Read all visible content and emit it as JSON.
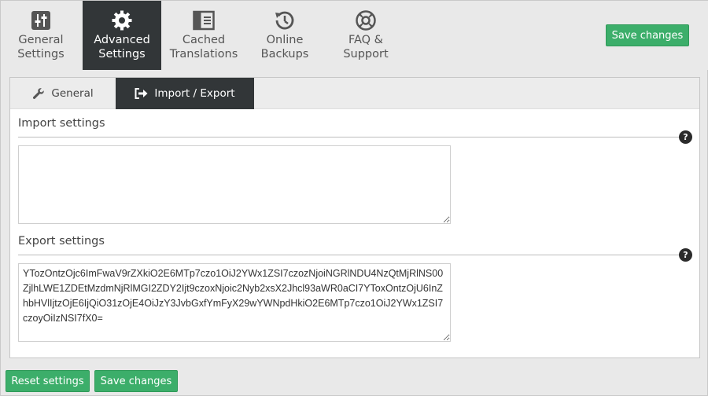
{
  "nav": {
    "tabs": [
      {
        "label": "General\nSettings",
        "icon": "sliders-icon"
      },
      {
        "label": "Advanced\nSettings",
        "icon": "gear-icon"
      },
      {
        "label": "Cached\nTranslations",
        "icon": "columns-icon"
      },
      {
        "label": "Online\nBackups",
        "icon": "history-icon"
      },
      {
        "label": "FAQ &\nSupport",
        "icon": "lifebuoy-icon"
      }
    ],
    "active_tab": "Advanced Settings",
    "save_label": "Save changes"
  },
  "subtabs": {
    "general": "General",
    "import_export": "Import / Export",
    "active": "Import / Export"
  },
  "import": {
    "title": "Import settings",
    "value": "",
    "help": "?"
  },
  "export": {
    "title": "Export settings",
    "value": "YTozOntzOjc6ImFwaV9rZXkiO2E6MTp7czo1OiJ2YWx1ZSI7czozNjoiNGRlNDU4NzQtMjRlNS00ZjlhLWE1ZDEtMzdmNjRlMGI2ZDY2Ijt9czoxNjoic2Nyb2xsX2Jhcl93aWR0aCI7YToxOntzOjU6InZhbHVlIjtzOjE6IjQiO31zOjE4OiJzY3JvbGxfYmFyX29wYWNpdHkiO2E6MTp7czo1OiJ2YWx1ZSI7czoyOiIzNSI7fX0=",
    "help": "?"
  },
  "footer": {
    "reset_label": "Reset settings",
    "save_label": "Save changes"
  },
  "colors": {
    "accent_green": "#3cae6a",
    "active_dark": "#323638"
  }
}
